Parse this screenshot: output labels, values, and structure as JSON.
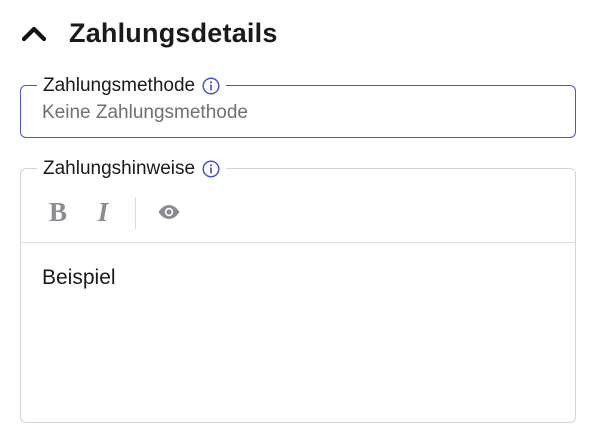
{
  "section": {
    "title": "Zahlungsdetails",
    "collapse_icon": "chevron-up-icon"
  },
  "payment_method": {
    "label": "Zahlungsmethode",
    "placeholder": "Keine Zahlungsmethode",
    "value": "",
    "info_icon": "info-icon",
    "accent_color": "#4a55c6"
  },
  "payment_notes": {
    "label": "Zahlungshinweise",
    "info_icon": "info-icon",
    "toolbar": {
      "bold_label": "B",
      "italic_label": "I",
      "preview_icon": "eye-icon"
    },
    "content": "Beispiel"
  }
}
